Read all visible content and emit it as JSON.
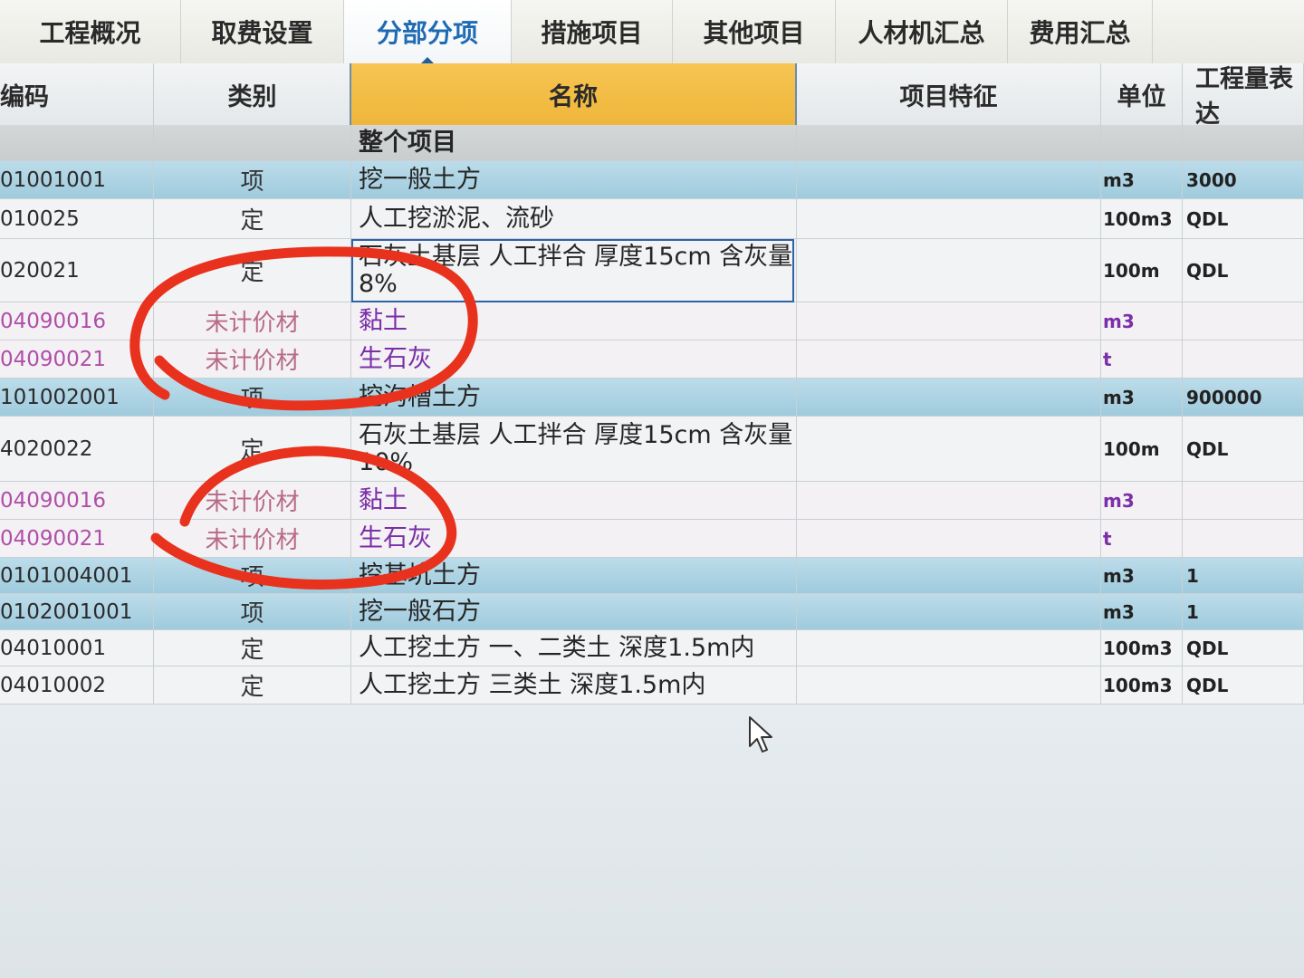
{
  "tabs": [
    {
      "label": "工程概况",
      "active": false
    },
    {
      "label": "取费设置",
      "active": false
    },
    {
      "label": "分部分项",
      "active": true
    },
    {
      "label": "措施项目",
      "active": false
    },
    {
      "label": "其他项目",
      "active": false
    },
    {
      "label": "人材机汇总",
      "active": false
    },
    {
      "label": "费用汇总",
      "active": false
    }
  ],
  "columns": {
    "code": "编码",
    "type": "类别",
    "name": "名称",
    "feature": "项目特征",
    "unit": "单位",
    "quantity": "工程量表达"
  },
  "rows": [
    {
      "kind": "group",
      "code": "",
      "type": "",
      "name": "整个项目",
      "unit": "",
      "qty": ""
    },
    {
      "kind": "item",
      "code": "01001001",
      "type": "项",
      "name": "挖一般土方",
      "unit": "m3",
      "qty": "3000"
    },
    {
      "kind": "quota",
      "code": "010025",
      "type": "定",
      "name": "人工挖淤泥、流砂",
      "unit": "100m3",
      "qty": "QDL"
    },
    {
      "kind": "quota",
      "code": "020021",
      "type": "定",
      "name": "石灰土基层 人工拌合 厚度15cm 含灰量 8%",
      "unit": "100m",
      "qty": "QDL"
    },
    {
      "kind": "material",
      "code": "04090016",
      "type": "未计价材",
      "name": "黏土",
      "unit": "m3",
      "qty": ""
    },
    {
      "kind": "material",
      "code": "04090021",
      "type": "未计价材",
      "name": "生石灰",
      "unit": "t",
      "qty": ""
    },
    {
      "kind": "item",
      "code": "101002001",
      "type": "项",
      "name": "挖沟槽土方",
      "unit": "m3",
      "qty": "900000"
    },
    {
      "kind": "quota",
      "code": "4020022",
      "type": "定",
      "name": "石灰土基层 人工拌合 厚度15cm 含灰量 10%",
      "unit": "100m",
      "qty": "QDL"
    },
    {
      "kind": "material",
      "code": "04090016",
      "type": "未计价材",
      "name": "黏土",
      "unit": "m3",
      "qty": ""
    },
    {
      "kind": "material",
      "code": "04090021",
      "type": "未计价材",
      "name": "生石灰",
      "unit": "t",
      "qty": ""
    },
    {
      "kind": "item",
      "code": "0101004001",
      "type": "项",
      "name": "挖基坑土方",
      "unit": "m3",
      "qty": "1"
    },
    {
      "kind": "item",
      "code": "0102001001",
      "type": "项",
      "name": "挖一般石方",
      "unit": "m3",
      "qty": "1"
    },
    {
      "kind": "quota",
      "code": "04010001",
      "type": "定",
      "name": "人工挖土方 一、二类土 深度1.5m内",
      "unit": "100m3",
      "qty": "QDL"
    },
    {
      "kind": "quota",
      "code": "04010002",
      "type": "定",
      "name": "人工挖土方 三类土 深度1.5m内",
      "unit": "100m3",
      "qty": "QDL"
    }
  ],
  "colors": {
    "active_tab": "#1f6bb3",
    "name_header": "#f0b93f",
    "item_row": "#a8d1e2",
    "material_text": "#7b2fa8",
    "annotation": "#e8321e"
  },
  "icons": {
    "cursor": "mouse-pointer-icon",
    "annotation": "red-circle-annotation"
  }
}
